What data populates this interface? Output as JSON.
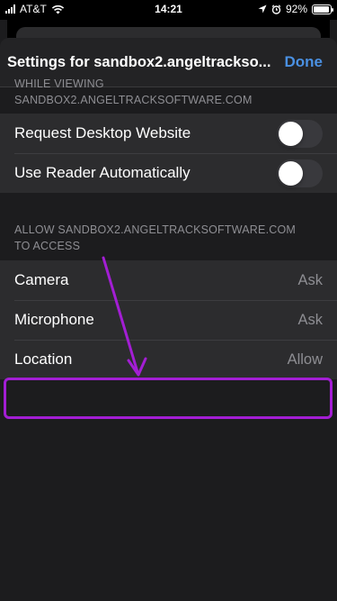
{
  "status_bar": {
    "carrier": "AT&T",
    "time": "14:21",
    "battery_percent": "92%",
    "battery_level": 0.92
  },
  "sheet": {
    "title": "Settings for sandbox2.angeltrackso...",
    "done_label": "Done"
  },
  "section_viewing": {
    "header_line1": "WHILE VIEWING",
    "header_line2": "SANDBOX2.ANGELTRACKSOFTWARE.COM",
    "rows": [
      {
        "label": "Request Desktop Website",
        "toggle_on": false
      },
      {
        "label": "Use Reader Automatically",
        "toggle_on": false
      }
    ]
  },
  "section_access": {
    "header_line1": "ALLOW SANDBOX2.ANGELTRACKSOFTWARE.COM",
    "header_line2": "TO ACCESS",
    "rows": [
      {
        "label": "Camera",
        "value": "Ask"
      },
      {
        "label": "Microphone",
        "value": "Ask"
      },
      {
        "label": "Location",
        "value": "Allow"
      }
    ]
  },
  "annotation": {
    "color": "#a31ed4",
    "target": "Location"
  },
  "colors": {
    "accent": "#4a90e2",
    "background": "#1c1c1e",
    "cell": "#2c2c2e",
    "secondary_text": "#8e8e93"
  }
}
